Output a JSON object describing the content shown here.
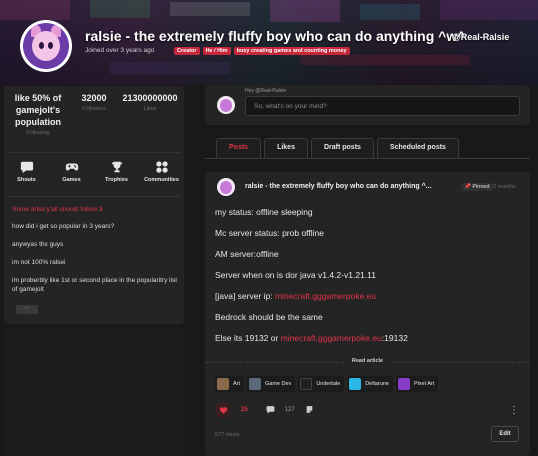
{
  "header": {
    "title": "ralsie - the extremely fluffy boy who can do anything ^w^",
    "handle": "@Real-Ralsie",
    "joined": "Joined over 3 years ago",
    "tags": [
      "Creator",
      "He / Him",
      "busy creating games and counting money"
    ]
  },
  "stats": [
    {
      "value": "like 50% of gamejolt's population",
      "label": "Following"
    },
    {
      "value": "32000",
      "label": "Followers"
    },
    {
      "value": "21300000000",
      "label": "Likes"
    }
  ],
  "nav_icons": [
    {
      "label": "Shouts",
      "icon": "chat-bubble-icon"
    },
    {
      "label": "Games",
      "icon": "gamepad-icon"
    },
    {
      "label": "Trophies",
      "icon": "trophy-icon"
    },
    {
      "label": "Communities",
      "icon": "communities-icon"
    }
  ],
  "bio": {
    "accent": "Some artist y'all should follow:3",
    "lines": [
      "how did i get so popular in 3 years?",
      "anywyas thx guys",
      "im not 100% ralsei",
      "im proberbly like 1st or second place in the popularitry list of gamejolt"
    ],
    "more_label": "···"
  },
  "composer": {
    "hey": "Hey @Real-Ralsie",
    "placeholder": "So, what's on your mind?"
  },
  "tabs": [
    "Posts",
    "Likes",
    "Draft posts",
    "Scheduled posts"
  ],
  "post": {
    "author": "ralsie - the extremely fluffy boy who can do anything ^...",
    "pinned": "Pinned",
    "ago": "2 months",
    "lines": [
      {
        "text": "my status: offline sleeping"
      },
      {
        "text": "Mc server status: prob offline"
      },
      {
        "text": "AM server:offline"
      },
      {
        "text": "Server when on is dor java v1.4.2-v1.21.11"
      },
      {
        "pre": "[java] server ip: ",
        "link": "minecraft.gggamerpoke.eu",
        "post": ""
      },
      {
        "text": "Bedrock should be the same"
      },
      {
        "pre": "Else its 19132 or  ",
        "link": "minecraft.gggamerpoke.eu",
        "post": ":19132"
      }
    ],
    "read_article": "Read article",
    "categories": [
      {
        "name": "Art",
        "color": "#8a6a4a"
      },
      {
        "name": "Game Dev",
        "color": "#5a6a7a"
      },
      {
        "name": "Undertale",
        "color": "#202020"
      },
      {
        "name": "Deltarune",
        "color": "#2ab8e8"
      },
      {
        "name": "Pixel Art",
        "color": "#8a3ac8"
      }
    ],
    "likes": "25",
    "comments": "127",
    "views": "577 views",
    "edit_label": "Edit",
    "more_label": "⋮"
  },
  "colors": {
    "accent": "#e0344a",
    "background": "#191919",
    "card": "#242424"
  }
}
